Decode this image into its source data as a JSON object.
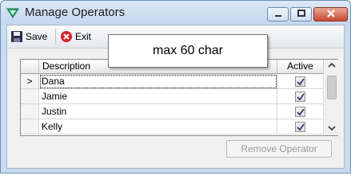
{
  "window": {
    "title": "Manage Operators",
    "accent": "#c9dcef"
  },
  "toolbar": {
    "save_label": "Save",
    "exit_label": "Exit"
  },
  "grid": {
    "headers": {
      "description": "Description",
      "active": "Active"
    },
    "current_row_marker": ">",
    "rows": [
      {
        "description": "Dana",
        "active": true,
        "current": true
      },
      {
        "description": "Jamie",
        "active": true
      },
      {
        "description": "Justin",
        "active": true
      },
      {
        "description": "Kelly",
        "active": true
      }
    ]
  },
  "tooltip": {
    "text": "max 60 char"
  },
  "actions": {
    "remove_operator_label": "Remove Operator",
    "remove_enabled": false
  }
}
